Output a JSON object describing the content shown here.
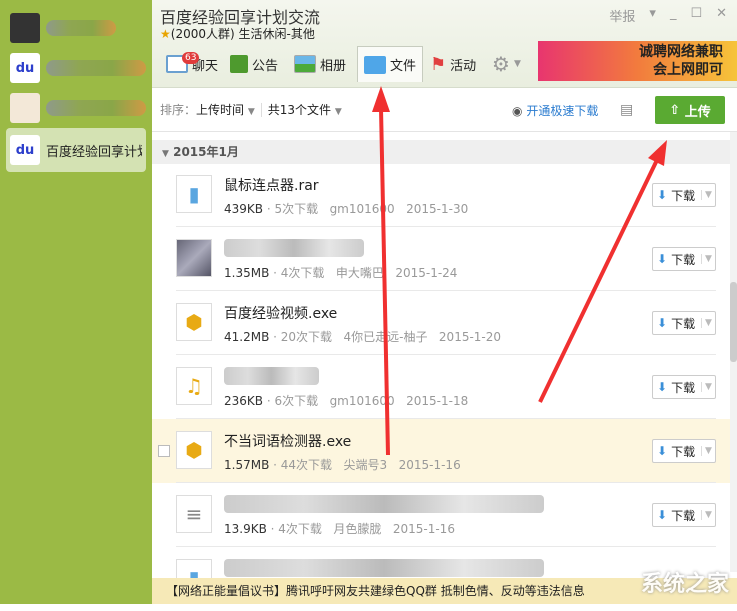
{
  "sidebar": {
    "items": [
      {
        "label": ""
      },
      {
        "label": ""
      },
      {
        "label": ""
      },
      {
        "label": "百度经验回享计划"
      }
    ]
  },
  "window": {
    "title": "百度经验回享计划交流",
    "subtitle": "(2000人群) 生活休闲-其他",
    "report": "举报"
  },
  "tabs": [
    {
      "label": "聊天",
      "badge": "63"
    },
    {
      "label": "公告"
    },
    {
      "label": "相册"
    },
    {
      "label": "文件"
    },
    {
      "label": "活动"
    }
  ],
  "ad": {
    "line1": "诚聘网络兼职",
    "line2": "会上网即可"
  },
  "toolbar": {
    "sort_label": "排序：",
    "sort_value": "上传时间",
    "count": "共13个文件",
    "vip": "开通极速下载",
    "upload": "上传"
  },
  "group": "2015年1月",
  "files": [
    {
      "name": "鼠标连点器.rar",
      "size": "439KB",
      "downloads": "5次下载",
      "uploader": "gm101600",
      "date": "2015-1-30",
      "icon": "zip"
    },
    {
      "name": "",
      "size": "1.35MB",
      "downloads": "4次下载",
      "uploader": "申大嘴巴",
      "date": "2015-1-24",
      "icon": "image"
    },
    {
      "name": "百度经验视频.exe",
      "size": "41.2MB",
      "downloads": "20次下载",
      "uploader": "4你已走远-柚子",
      "date": "2015-1-20",
      "icon": "exe"
    },
    {
      "name": "",
      "size": "236KB",
      "downloads": "6次下载",
      "uploader": "gm101600",
      "date": "2015-1-18",
      "icon": "music"
    },
    {
      "name": "不当词语检测器.exe",
      "size": "1.57MB",
      "downloads": "44次下载",
      "uploader": "尖端号3",
      "date": "2015-1-16",
      "icon": "exe"
    },
    {
      "name": "",
      "size": "13.9KB",
      "downloads": "4次下载",
      "uploader": "月色朦胧",
      "date": "2015-1-16",
      "icon": "doc"
    }
  ],
  "download_label": "下载",
  "footer": "【网络正能量倡议书】腾讯呼吁网友共建绿色QQ群 抵制色情、反动等违法信息",
  "watermark": "系统之家",
  "colors": {
    "sidebar": "#9bba45",
    "upload": "#5aaa32",
    "arrow": "#f03030"
  }
}
